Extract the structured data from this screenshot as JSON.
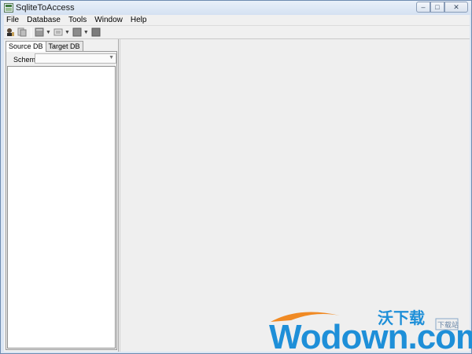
{
  "window": {
    "title": "SqliteToAccess",
    "controls": {
      "minimize": "–",
      "maximize": "□",
      "close": "✕"
    }
  },
  "menu": {
    "items": [
      {
        "label": "File"
      },
      {
        "label": "Database"
      },
      {
        "label": "Tools"
      },
      {
        "label": "Window"
      },
      {
        "label": "Help"
      }
    ]
  },
  "toolbar": {
    "buttons": [
      {
        "icon": "connect-icon"
      },
      {
        "icon": "disconnect-icon"
      },
      {
        "icon": "table-icon",
        "has_dropdown": true
      },
      {
        "icon": "query-icon",
        "has_dropdown": true
      },
      {
        "icon": "export-icon",
        "has_dropdown": true
      },
      {
        "icon": "stop-icon"
      }
    ]
  },
  "left_panel": {
    "tabs": [
      {
        "label": "Source DB",
        "active": true
      },
      {
        "label": "Target DB",
        "active": false
      }
    ],
    "schema": {
      "label": "Schema",
      "value": ""
    }
  },
  "watermark": {
    "cn_text": "沃下载",
    "brand_text": "Wodown.com",
    "badge_text": "下载站"
  },
  "colors": {
    "client_bg": "#f0f0f0",
    "titlebar_bg": "#d4e1f2",
    "watermark_blue": "#1e8fd8",
    "watermark_orange": "#f08a24"
  }
}
